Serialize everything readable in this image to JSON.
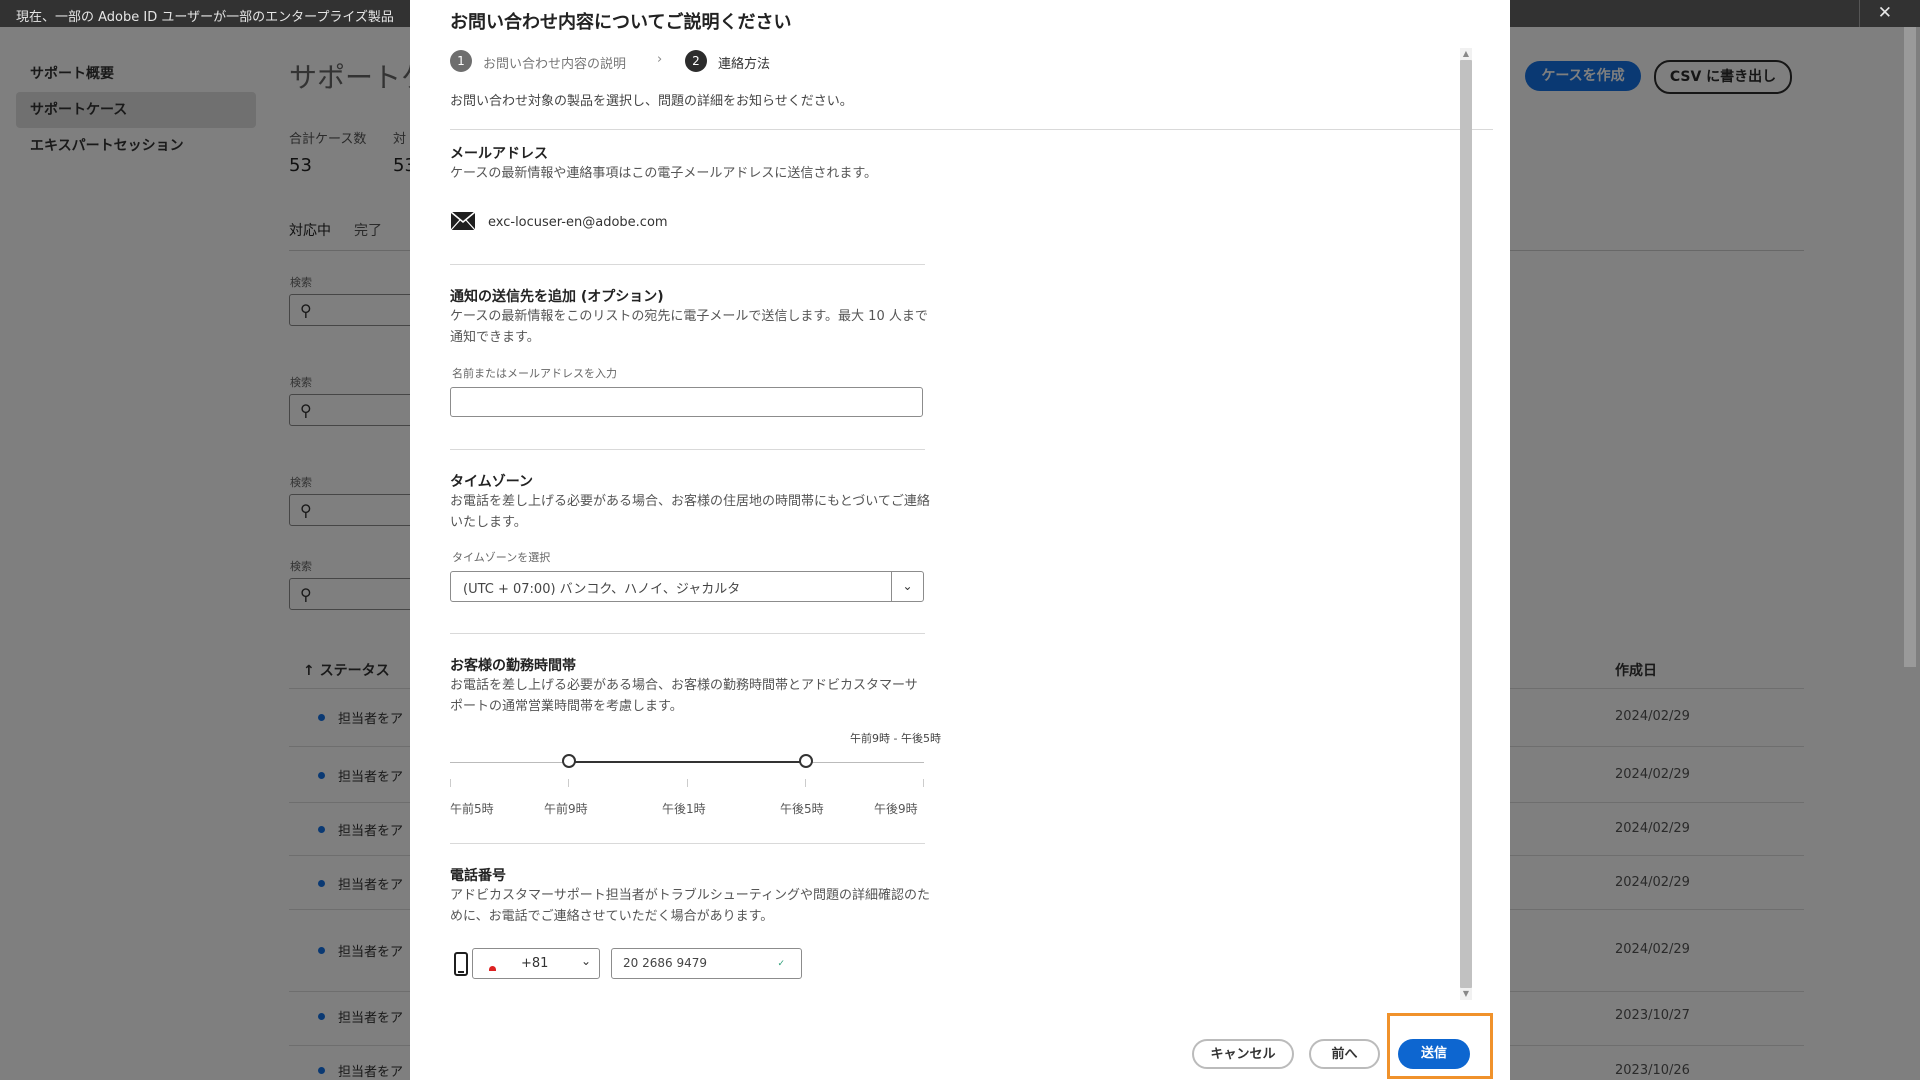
{
  "topbar": {
    "notice": "現在、一部の Adobe ID ユーザーが一部のエンタープライズ製品",
    "close": "✕"
  },
  "sidebar": {
    "items": [
      {
        "label": "サポート概要"
      },
      {
        "label": "サポートケース"
      },
      {
        "label": "エキスパートセッション"
      }
    ]
  },
  "page": {
    "title": "サポートケ",
    "stats": [
      {
        "label": "合計ケース数",
        "value": "53"
      },
      {
        "label": "対",
        "value": "53"
      }
    ],
    "tabs": [
      {
        "label": "対応中"
      },
      {
        "label": "完了"
      }
    ],
    "search_label": "検索",
    "create_case": "ケースを作成",
    "export_csv": "CSV に書き出し",
    "table": {
      "col_status": "↑ ステータス",
      "col_created": "作成日",
      "rows": [
        {
          "status": "担当者をア",
          "date": "2024/02/29"
        },
        {
          "status": "担当者をア",
          "date": "2024/02/29"
        },
        {
          "status": "担当者をア",
          "date": "2024/02/29"
        },
        {
          "status": "担当者をア",
          "date": "2024/02/29"
        },
        {
          "status": "担当者をア",
          "date": "2024/02/29"
        },
        {
          "status": "担当者をア",
          "date": "2023/10/27"
        },
        {
          "status": "担当者をア",
          "date": "2023/10/26"
        }
      ]
    }
  },
  "modal": {
    "title": "お問い合わせ内容についてご説明ください",
    "steps": [
      {
        "num": "1",
        "label": "お問い合わせ内容の説明"
      },
      {
        "num": "2",
        "label": "連絡方法"
      }
    ],
    "step_separator": "›",
    "description": "お問い合わせ対象の製品を選択し、問題の詳細をお知らせください。",
    "email": {
      "heading": "メールアドレス",
      "desc": "ケースの最新情報や連絡事項はこの電子メールアドレスに送信されます。",
      "address": "exc-locuser-en@adobe.com"
    },
    "notify": {
      "heading": "通知の送信先を追加 (オプション)",
      "desc": "ケースの最新情報をこのリストの宛先に電子メールで送信します。最大 10 人まで通知できます。",
      "field_label": "名前またはメールアドレスを入力",
      "value": ""
    },
    "timezone": {
      "heading": "タイムゾーン",
      "desc": "お電話を差し上げる必要がある場合、お客様の住居地の時間帯にもとづいてご連絡いたします。",
      "field_label": "タイムゾーンを選択",
      "value": "(UTC + 07:00) バンコク、ハノイ、ジャカルタ"
    },
    "hours": {
      "heading": "お客様の勤務時間帯",
      "desc": "お電話を差し上げる必要がある場合、お客様の勤務時間帯とアドビカスタマーサポートの通常営業時間帯を考慮します。",
      "range_label": "午前9時 - 午後5時",
      "range_start_fraction": 0.25,
      "range_end_fraction": 0.75,
      "ticks": [
        "午前5時",
        "午前9時",
        "午後1時",
        "午後5時",
        "午後9時"
      ]
    },
    "phone": {
      "heading": "電話番号",
      "desc": "アドビカスタマーサポート担当者がトラブルシューティングや問題の詳細確認のために、お電話でご連絡させていただく場合があります。",
      "country_code": "+81",
      "number": "20 2686 9479"
    },
    "buttons": {
      "cancel": "キャンセル",
      "prev": "前へ",
      "send": "送信"
    }
  }
}
